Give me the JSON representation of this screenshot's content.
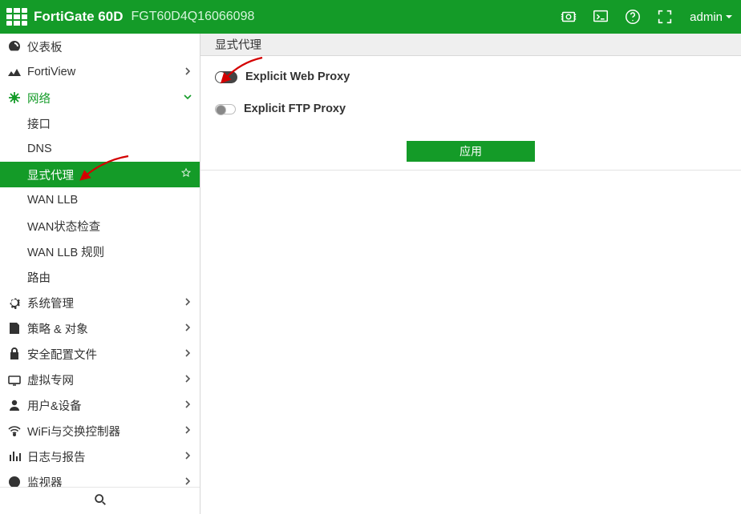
{
  "header": {
    "product": "FortiGate 60D",
    "serial": "FGT60D4Q16066098",
    "admin_label": "admin"
  },
  "sidebar": {
    "dashboard": "仪表板",
    "fortiview": "FortiView",
    "network": "网络",
    "network_items": {
      "interface": "接口",
      "dns": "DNS",
      "explicit_proxy": "显式代理",
      "wan_llb": "WAN LLB",
      "wan_status": "WAN状态检查",
      "wan_llb_rule": "WAN LLB 规则",
      "route": "路由"
    },
    "system": "系统管理",
    "policy": "策略 & 对象",
    "security": "安全配置文件",
    "vpn": "虚拟专网",
    "user": "用户&设备",
    "wifi": "WiFi与交换控制器",
    "log": "日志与报告",
    "monitor": "监视器"
  },
  "content": {
    "section_title": "显式代理",
    "web_proxy_label": "Explicit Web Proxy",
    "ftp_proxy_label": "Explicit FTP Proxy",
    "apply_label": "应用",
    "web_proxy_on": true,
    "ftp_proxy_on": false
  },
  "colors": {
    "brand": "#149b28"
  }
}
